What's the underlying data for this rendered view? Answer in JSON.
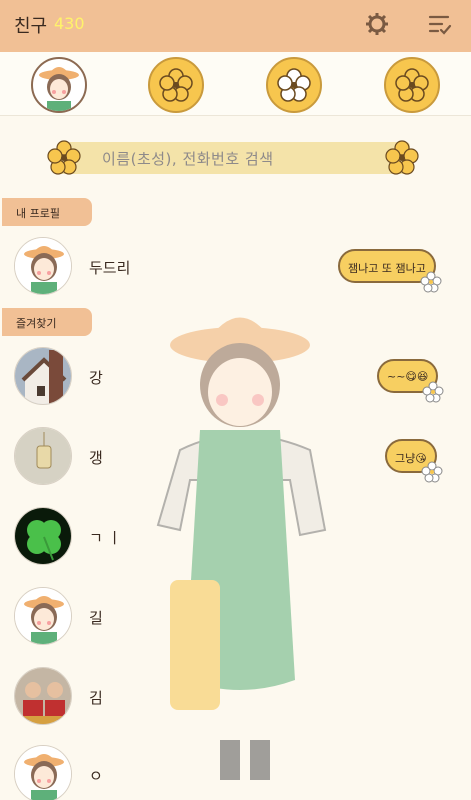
{
  "header": {
    "title": "친구",
    "count": "430",
    "settings_icon": "gear-icon",
    "menu_icon": "list-check-icon"
  },
  "tabs": [
    {
      "icon": "profile-avatar-icon"
    },
    {
      "icon": "yellow-flower-icon"
    },
    {
      "icon": "white-flower-icon"
    },
    {
      "icon": "yellow-flower-icon"
    }
  ],
  "search": {
    "placeholder": "이름(초성), 전화번호 검색"
  },
  "sections": {
    "my_profile": "내 프로필",
    "favorites": "즐겨찾기"
  },
  "my_profile": {
    "name": "두드리",
    "status": "잼나고 또 잼나고"
  },
  "favorites": [
    {
      "name": "강",
      "status": "~~😋😆",
      "avatar": "house-photo"
    },
    {
      "name": "갱",
      "status": "그냥😘",
      "avatar": "jar-photo"
    },
    {
      "name": "ㄱ ㅣ",
      "status": "",
      "avatar": "clover-photo"
    },
    {
      "name": "길",
      "status": "",
      "avatar": "girl-avatar"
    },
    {
      "name": "김",
      "status": "",
      "avatar": "kids-photo"
    },
    {
      "name": "ㅇ",
      "status": "",
      "avatar": "girl-avatar"
    }
  ],
  "colors": {
    "header_bg": "#f1c095",
    "count_color": "#fff36a",
    "accent_yellow": "#f7c64e",
    "search_bg": "#f4e3a9",
    "page_bg": "#fdf9ef"
  }
}
